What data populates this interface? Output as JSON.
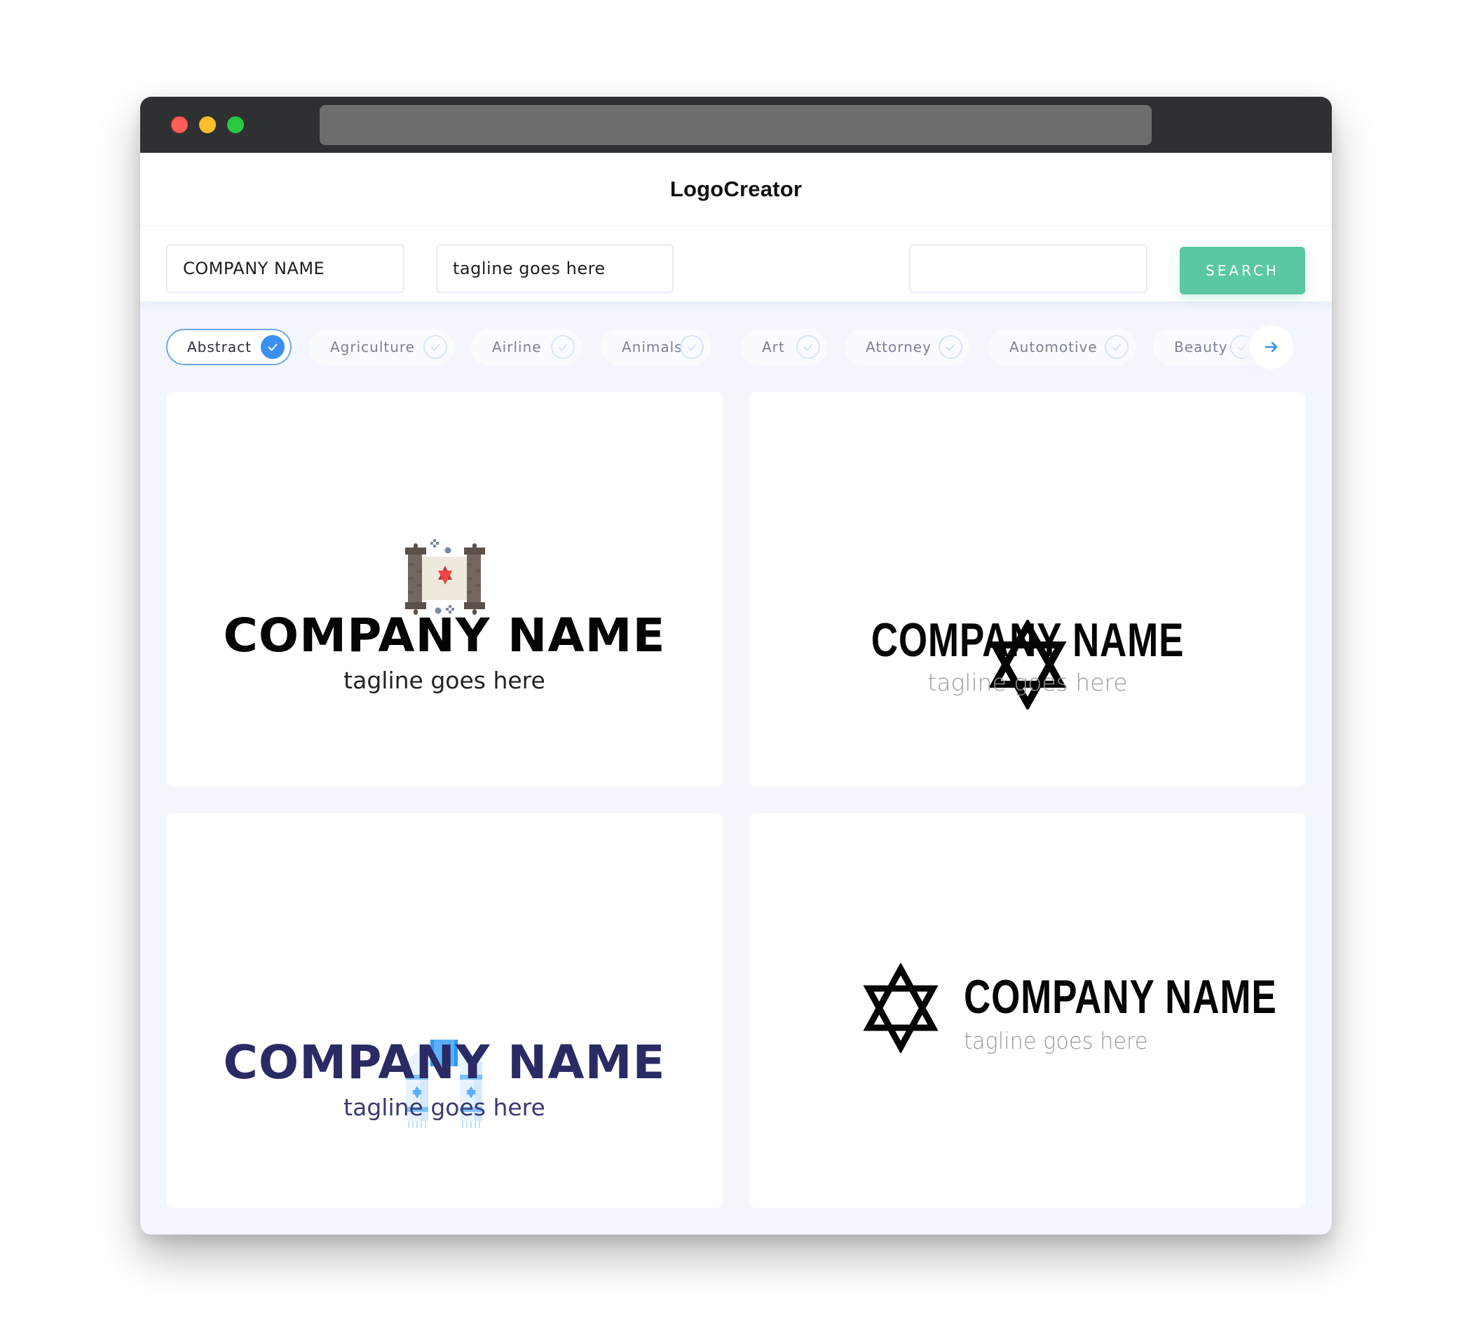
{
  "window": {
    "controls": [
      "close",
      "minimize",
      "maximize"
    ],
    "address_bar": ""
  },
  "header": {
    "title": "LogoCreator"
  },
  "search": {
    "company_name_value": "COMPANY NAME",
    "tagline_value": "tagline goes here",
    "extra_value": "",
    "button_label": "SEARCH"
  },
  "categories": {
    "items": [
      {
        "label": "Abstract",
        "selected": true
      },
      {
        "label": "Agriculture",
        "selected": false
      },
      {
        "label": "Airline",
        "selected": false
      },
      {
        "label": "Animals",
        "selected": false
      },
      {
        "label": "Art",
        "selected": false
      },
      {
        "label": "Attorney",
        "selected": false
      },
      {
        "label": "Automotive",
        "selected": false
      },
      {
        "label": "Beauty",
        "selected": false
      }
    ],
    "next_icon": "arrow-right-icon"
  },
  "logos": [
    {
      "icon": "torah-scroll-icon",
      "company": "COMPANY NAME",
      "tagline": "tagline goes here",
      "name_color": "#050505",
      "layout": "stacked"
    },
    {
      "icon": "star-of-david-icon",
      "company": "COMPANY NAME",
      "tagline": "tagline goes here",
      "name_color": "#050505",
      "layout": "stacked"
    },
    {
      "icon": "tallit-scarf-icon",
      "company": "COMPANY NAME",
      "tagline": "tagline goes here",
      "name_color": "#2a2a64",
      "layout": "stacked"
    },
    {
      "icon": "star-of-david-icon",
      "company": "COMPANY NAME",
      "tagline": "tagline goes here",
      "name_color": "#050505",
      "layout": "inline"
    }
  ],
  "colors": {
    "accent_green": "#5ac8a0",
    "accent_blue": "#3a8ff0",
    "titlebar": "#2f3032",
    "page_bg": "#f3f6fd"
  }
}
